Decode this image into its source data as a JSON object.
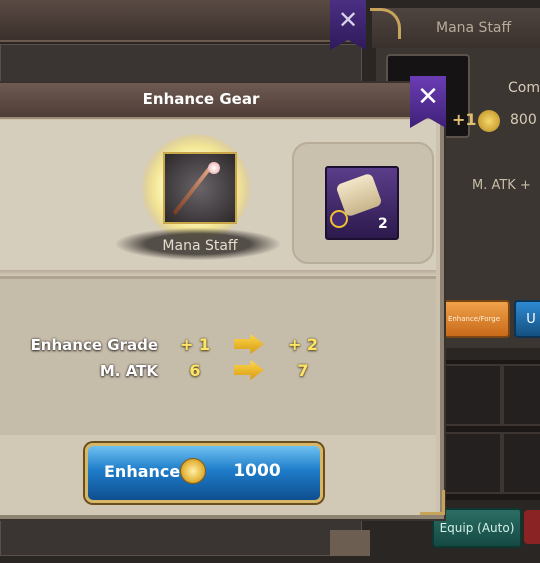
{
  "background": {
    "right_title": "Mana Staff",
    "slot_level": "+1",
    "compare_label": "Com",
    "price": "800",
    "matk_text": "M. ATK +",
    "enhance_forge_label": "Enhance/Forge",
    "blue_btn_label": "U",
    "equip_auto_label": "Equip (Auto)"
  },
  "dialog": {
    "title": "Enhance Gear",
    "close_icon": "close-icon",
    "item": {
      "name": "Mana Staff",
      "icon": "staff-icon"
    },
    "material": {
      "icon": "scroll-icon",
      "count": "2",
      "magnify_icon": "magnifier-icon"
    },
    "stats": [
      {
        "label": "Enhance Grade",
        "from": "+ 1",
        "to": "+ 2"
      },
      {
        "label": "M. ATK",
        "from": "6",
        "to": "7"
      }
    ],
    "enhance_button": {
      "label": "Enhance",
      "coin_icon": "gold-coin-icon",
      "cost": "1000"
    }
  },
  "colors": {
    "accent_gold": "#ffe566",
    "ribbon_purple": "#4f2c95",
    "button_blue": "#1e7cc9"
  }
}
